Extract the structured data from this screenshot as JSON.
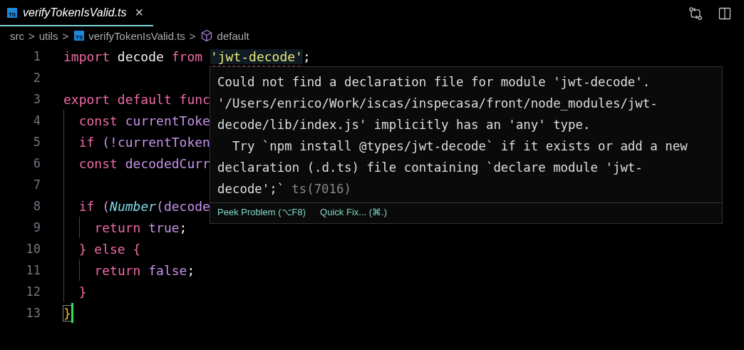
{
  "tab": {
    "filename": "verifyTokenIsValid.ts",
    "icon": "TS",
    "selected": true,
    "close": "×"
  },
  "breadcrumb": [
    {
      "kind": "text",
      "text": "src"
    },
    {
      "kind": "sep",
      "text": ">"
    },
    {
      "kind": "text",
      "text": "utils"
    },
    {
      "kind": "sep",
      "text": ">"
    },
    {
      "kind": "file",
      "icon": "TS",
      "text": "verifyTokenIsValid.ts"
    },
    {
      "kind": "sep",
      "text": ">"
    },
    {
      "kind": "symbol",
      "text": "default"
    }
  ],
  "lines": [
    {
      "number": "1",
      "tokens": [
        {
          "kind": "keyword",
          "text": "import "
        },
        {
          "kind": "plain",
          "text": "decode "
        },
        {
          "kind": "keyword",
          "text": "from "
        },
        {
          "kind": "error-string",
          "text": "'jwt-decode'"
        },
        {
          "kind": "plain",
          "text": ";"
        }
      ]
    },
    {
      "number": "2"
    },
    {
      "number": "3",
      "tokens": [
        {
          "kind": "keyword",
          "text": "export default func"
        }
      ],
      "children": [
        {
          "number": "4",
          "tokens": [
            {
              "kind": "keyword",
              "text": "const "
            },
            {
              "kind": "var",
              "text": "currentToke"
            }
          ]
        },
        {
          "number": "5",
          "tokens": [
            {
              "kind": "keyword",
              "text": "if "
            },
            {
              "kind": "var",
              "text": "(!currentToken"
            }
          ]
        },
        {
          "number": "6",
          "tokens": [
            {
              "kind": "keyword",
              "text": "const "
            },
            {
              "kind": "var",
              "text": "decodedCurr"
            }
          ]
        },
        {
          "number": "7"
        },
        {
          "number": "8",
          "tokens": [
            {
              "kind": "keyword",
              "text": "if "
            },
            {
              "kind": "var",
              "text": "("
            },
            {
              "kind": "func",
              "text": "Number"
            },
            {
              "kind": "var",
              "text": "(decode"
            }
          ],
          "children": [
            {
              "number": "9",
              "tokens": [
                {
                  "kind": "keyword",
                  "text": "return "
                },
                {
                  "kind": "var",
                  "text": "true"
                },
                {
                  "kind": "plain",
                  "text": ";"
                }
              ]
            }
          ]
        },
        {
          "number": "10",
          "tokens": [
            {
              "kind": "keyword",
              "text": "} else {"
            }
          ],
          "children": [
            {
              "number": "11",
              "tokens": [
                {
                  "kind": "keyword",
                  "text": "return "
                },
                {
                  "kind": "var",
                  "text": "false"
                },
                {
                  "kind": "plain",
                  "text": ";"
                }
              ]
            }
          ]
        },
        {
          "number": "12",
          "tokens": [
            {
              "kind": "keyword",
              "text": "}"
            }
          ]
        }
      ]
    },
    {
      "number": "13",
      "tokens": [
        {
          "kind": "matched-bracket",
          "text": "}"
        }
      ],
      "cursor": true
    }
  ],
  "hover": {
    "message_lines": [
      "Could not find a declaration file for module 'jwt-decode'.",
      "'/Users/enrico/Work/iscas/inspecasa/front/node_modules/jwt-",
      "decode/lib/index.js' implicitly has an 'any' type.",
      "  Try `npm install @types/jwt-decode` if it exists or add a new",
      "declaration (.d.ts) file containing `declare module 'jwt-",
      "decode';`"
    ],
    "code": "ts(7016)",
    "actions": [
      "Peek Problem (⌥F8)",
      "Quick Fix... (⌘.)"
    ]
  }
}
